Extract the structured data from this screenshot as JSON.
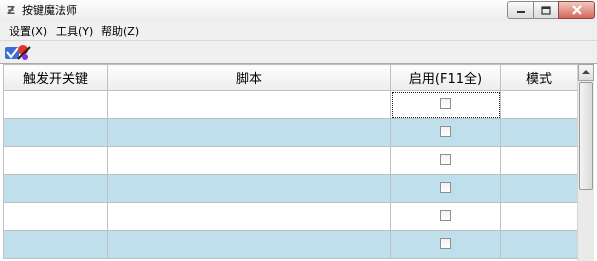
{
  "window": {
    "title": "按键魔法师",
    "icon": "script-icon",
    "controls": [
      "minimize-icon",
      "maximize-icon",
      "close-icon"
    ]
  },
  "menubar": {
    "items": [
      {
        "label": "设置(X)"
      },
      {
        "label": "工具(Y)"
      },
      {
        "label": "帮助(Z)"
      }
    ]
  },
  "toolbar": {
    "buttons": [
      {
        "icon": "wizard-icon"
      }
    ]
  },
  "table": {
    "columns": [
      {
        "label": "触发开关键"
      },
      {
        "label": "脚本"
      },
      {
        "label": "启用(F11全)"
      },
      {
        "label": "模式"
      }
    ],
    "rows": [
      {
        "key": "",
        "script": "",
        "enabled": false,
        "mode": ""
      },
      {
        "key": "",
        "script": "",
        "enabled": false,
        "mode": ""
      },
      {
        "key": "",
        "script": "",
        "enabled": false,
        "mode": ""
      },
      {
        "key": "",
        "script": "",
        "enabled": false,
        "mode": ""
      },
      {
        "key": "",
        "script": "",
        "enabled": false,
        "mode": ""
      },
      {
        "key": "",
        "script": "",
        "enabled": false,
        "mode": ""
      }
    ],
    "row_colors": [
      "#ffffff",
      "#bfdfed"
    ],
    "focused_row": 0
  },
  "colors": {
    "close_button": "#d8665a",
    "alt_row": "#bfdfed"
  }
}
